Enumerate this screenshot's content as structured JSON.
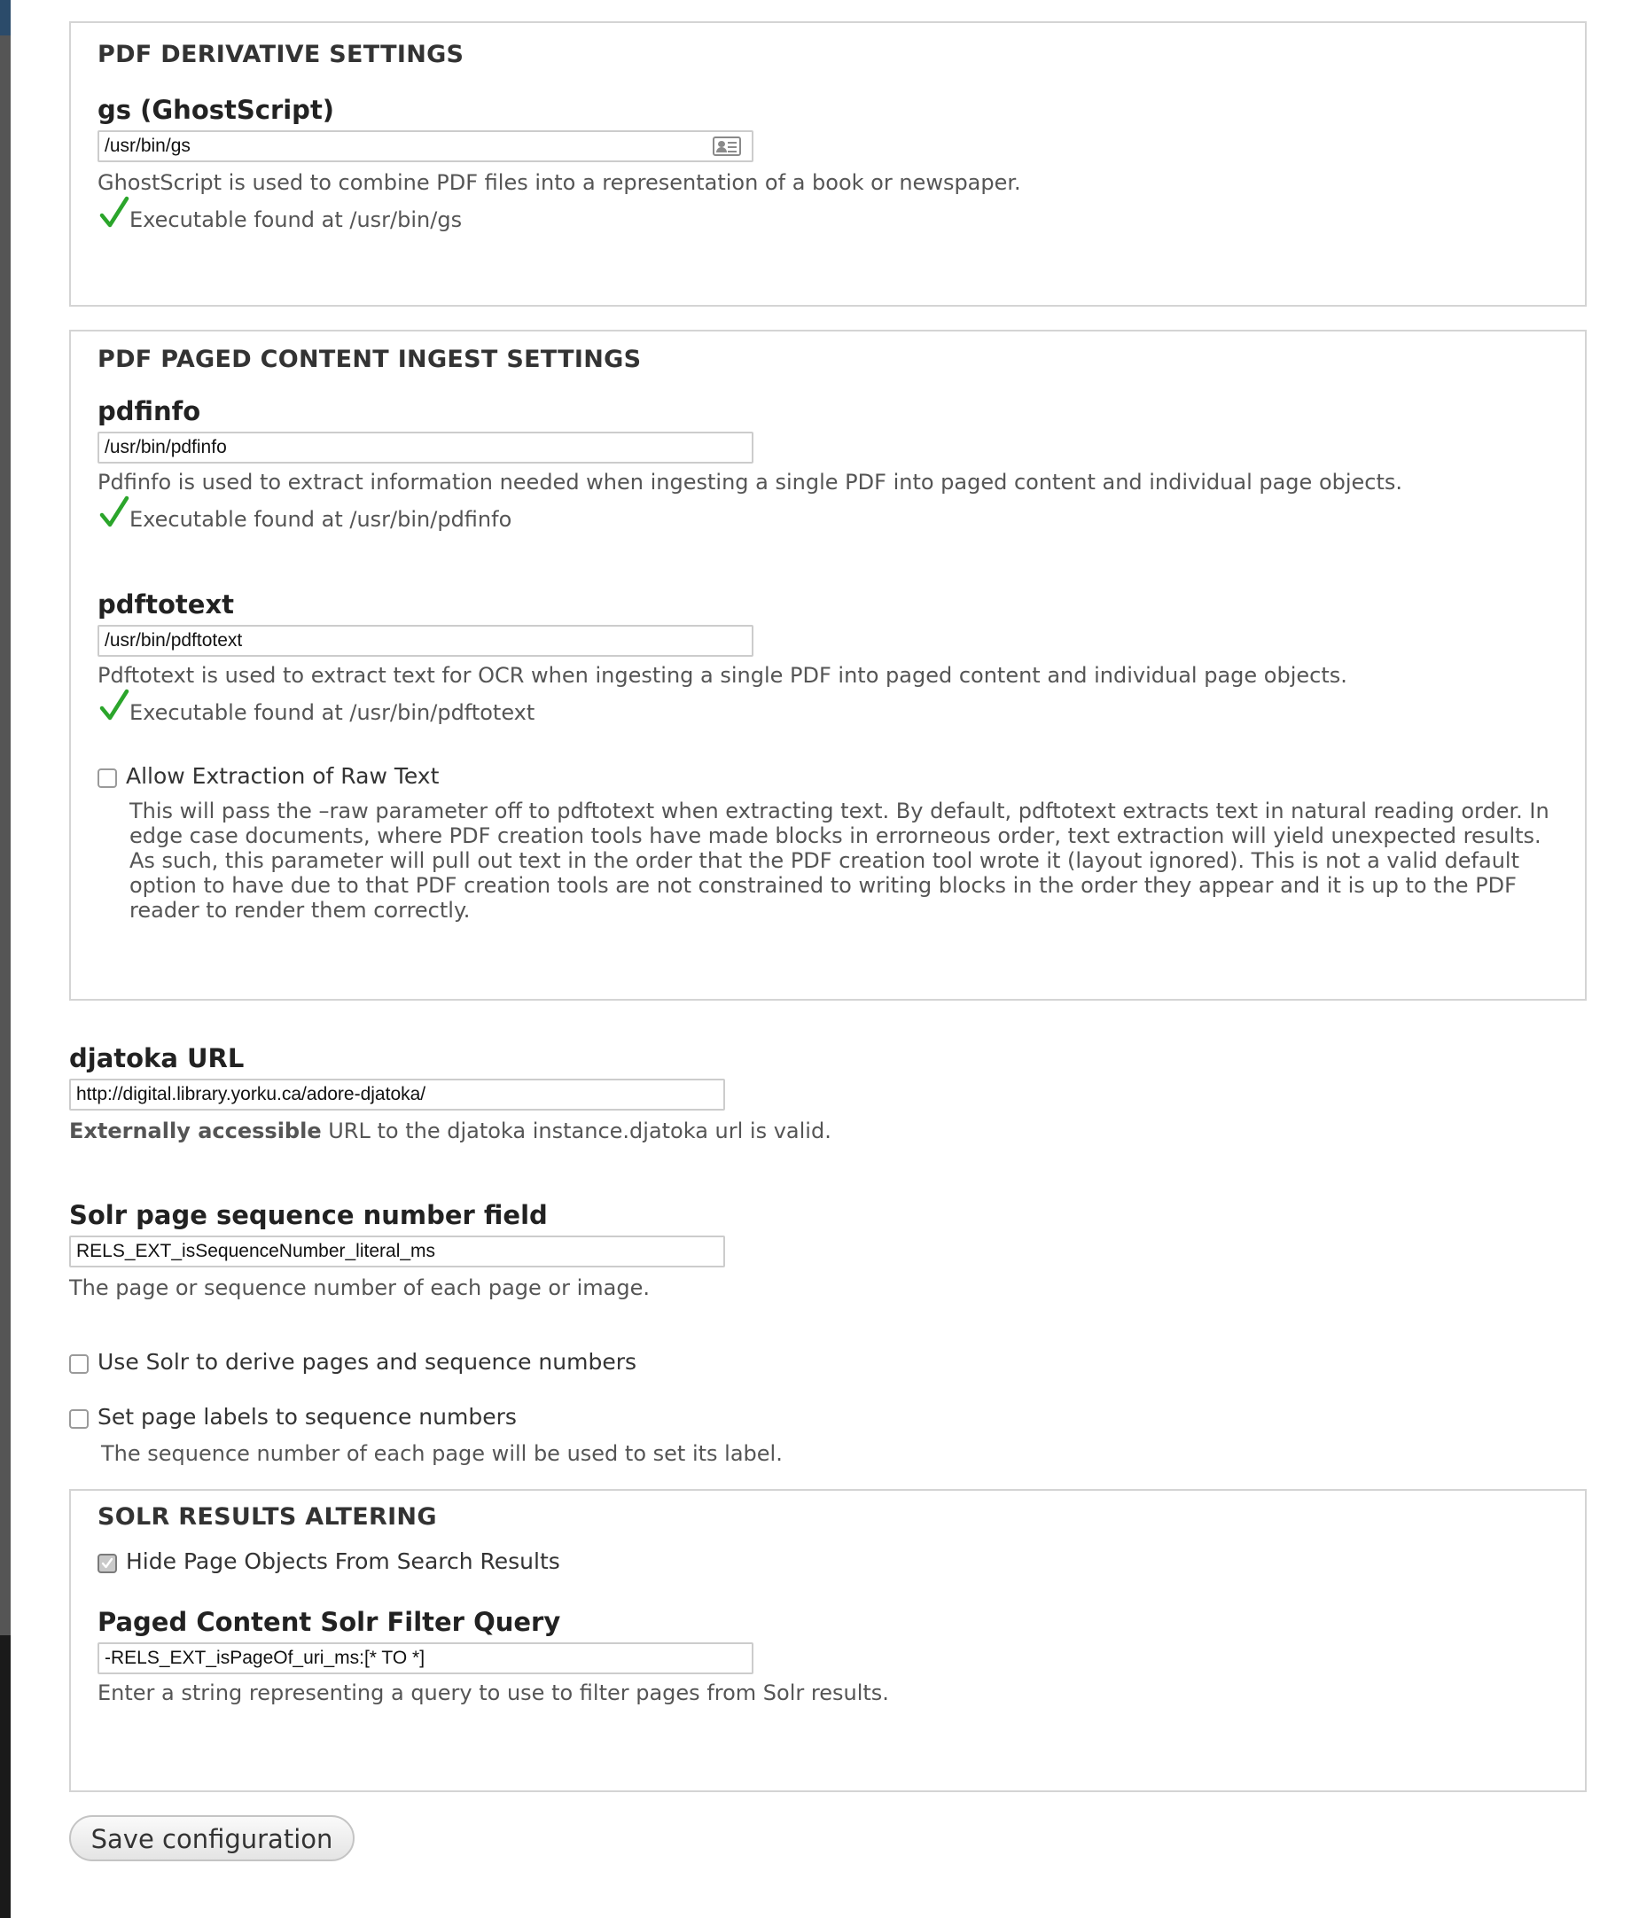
{
  "pdf_derivative": {
    "legend": "PDF DERIVATIVE SETTINGS",
    "gs_label": "gs (GhostScript)",
    "gs_value": "/usr/bin/gs",
    "gs_description": "GhostScript is used to combine PDF files into a representation of a book or newspaper.",
    "gs_status": "Executable found at /usr/bin/gs"
  },
  "pdf_ingest": {
    "legend": "PDF PAGED CONTENT INGEST SETTINGS",
    "pdfinfo_label": "pdfinfo",
    "pdfinfo_value": "/usr/bin/pdfinfo",
    "pdfinfo_description": "Pdfinfo is used to extract information needed when ingesting a single PDF into paged content and individual page objects.",
    "pdfinfo_status": "Executable found at /usr/bin/pdfinfo",
    "pdftotext_label": "pdftotext",
    "pdftotext_value": "/usr/bin/pdftotext",
    "pdftotext_description": "Pdftotext is used to extract text for OCR when ingesting a single PDF into paged content and individual page objects.",
    "pdftotext_status": "Executable found at /usr/bin/pdftotext",
    "raw_text_label": "Allow Extraction of Raw Text",
    "raw_text_checked": false,
    "raw_text_description": "This will pass the –raw parameter off to pdftotext when extracting text. By default, pdftotext extracts text in natural reading order. In edge case documents, where PDF creation tools have made blocks in errorneous order, text extraction will yield unexpected results. As such, this parameter will pull out text in the order that the PDF creation tool wrote it (layout ignored). This is not a valid default option to have due to that PDF creation tools are not constrained to writing blocks in the order they appear and it is up to the PDF reader to render them correctly."
  },
  "djatoka": {
    "label": "djatoka URL",
    "value": "http://digital.library.yorku.ca/adore-djatoka/",
    "description_strong": "Externally accessible",
    "description_rest": " URL to the djatoka instance.djatoka url is valid."
  },
  "solr_sequence": {
    "label": "Solr page sequence number field",
    "value": "RELS_EXT_isSequenceNumber_literal_ms",
    "description": "The page or sequence number of each page or image."
  },
  "use_solr": {
    "label": "Use Solr to derive pages and sequence numbers",
    "checked": false
  },
  "set_labels": {
    "label": "Set page labels to sequence numbers",
    "checked": false,
    "description": "The sequence number of each page will be used to set its label."
  },
  "solr_results": {
    "legend": "SOLR RESULTS ALTERING",
    "hide_label": "Hide Page Objects From Search Results",
    "hide_checked": true,
    "query_label": "Paged Content Solr Filter Query",
    "query_value": "-RELS_EXT_isPageOf_uri_ms:[* TO *]",
    "query_description": "Enter a string representing a query to use to filter pages from Solr results."
  },
  "actions": {
    "save_label": "Save configuration"
  },
  "icons": {
    "status_check": "check-icon",
    "contact_card": "contact-card-icon"
  },
  "colors": {
    "check_green": "#2ba52b",
    "fieldset_border": "#d4d4d4"
  }
}
